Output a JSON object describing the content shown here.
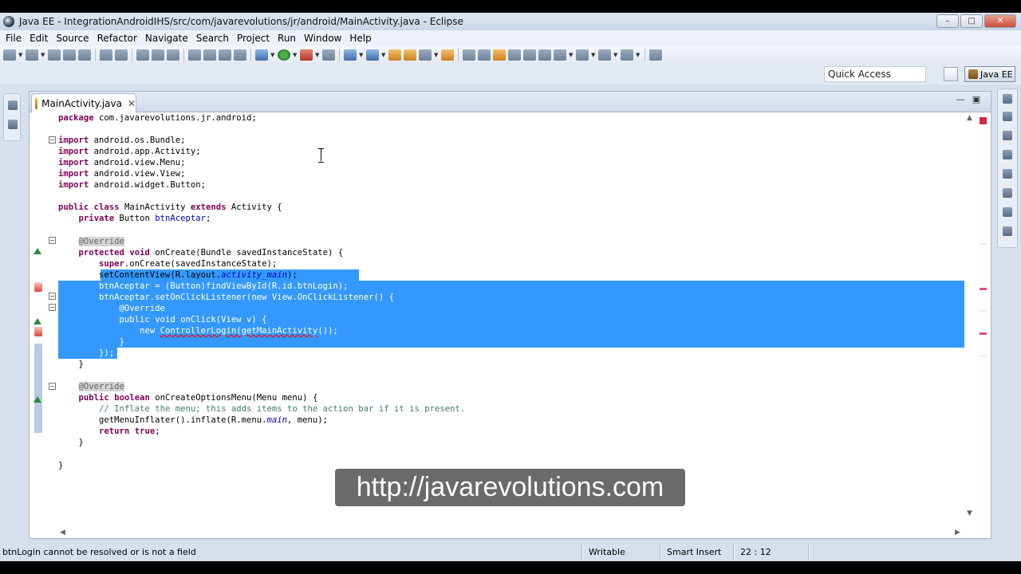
{
  "window": {
    "title": "Java EE - IntegrationAndroidIHS/src/com/javarevolutions/jr/android/MainActivity.java - Eclipse"
  },
  "menubar": {
    "items": [
      "File",
      "Edit",
      "Source",
      "Refactor",
      "Navigate",
      "Search",
      "Project",
      "Run",
      "Window",
      "Help"
    ]
  },
  "toolbar": {
    "quick_access_placeholder": "Quick Access",
    "perspective_label": "Java EE"
  },
  "editor": {
    "tab_label": "MainActivity.java",
    "code": [
      "package com.javarevolutions.jr.android;",
      "",
      "import android.os.Bundle;",
      "import android.app.Activity;",
      "import android.view.Menu;",
      "import android.view.View;",
      "import android.widget.Button;",
      "",
      "public class MainActivity extends Activity {",
      "    private Button btnAceptar;",
      "",
      "    @Override",
      "    protected void onCreate(Bundle savedInstanceState) {",
      "        super.onCreate(savedInstanceState);",
      "        setContentView(R.layout.activity_main);",
      "        btnAceptar = (Button)findViewById(R.id.btnLogin);",
      "        btnAceptar.setOnClickListener(new View.OnClickListener() {",
      "            @Override",
      "            public void onClick(View v) {",
      "                new ControllerLogin(getMainActivity());",
      "            }",
      "        });",
      "    }",
      "",
      "    @Override",
      "    public boolean onCreateOptionsMenu(Menu menu) {",
      "        // Inflate the menu; this adds items to the action bar if it is present.",
      "        getMenuInflater().inflate(R.menu.main, menu);",
      "        return true;",
      "    }",
      "",
      "}"
    ]
  },
  "watermark": {
    "text": "http://javarevolutions.com"
  },
  "statusbar": {
    "message": "btnLogin cannot be resolved or is not a field",
    "writable": "Writable",
    "insert_mode": "Smart Insert",
    "position": "22 : 12"
  }
}
